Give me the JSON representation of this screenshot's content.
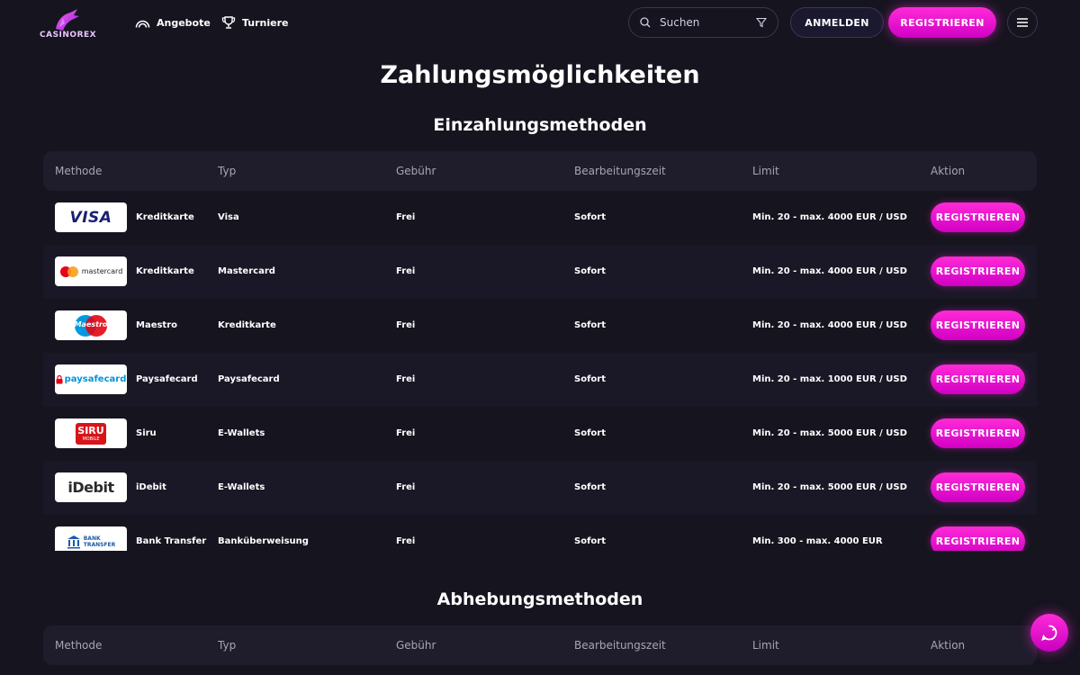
{
  "header": {
    "logo_text": "CASINOREX",
    "nav": [
      {
        "label": "Angebote",
        "icon": "gauge-icon"
      },
      {
        "label": "Turniere",
        "icon": "trophy-icon"
      }
    ],
    "search_placeholder": "Suchen",
    "login_label": "ANMELDEN",
    "register_label": "REGISTRIEREN"
  },
  "page_title": "Zahlungsmöglichkeiten",
  "deposit": {
    "title": "Einzahlungsmethoden",
    "columns": [
      "Methode",
      "Typ",
      "Gebühr",
      "Bearbeitungszeit",
      "Limit",
      "Aktion"
    ],
    "rows": [
      {
        "logo": "visa",
        "method": "Kreditkarte",
        "type": "Visa",
        "fee": "Frei",
        "time": "Sofort",
        "limit": "Min. 20 - max. 4000 EUR / USD",
        "action": "REGISTRIEREN"
      },
      {
        "logo": "mastercard",
        "method": "Kreditkarte",
        "type": "Mastercard",
        "fee": "Frei",
        "time": "Sofort",
        "limit": "Min. 20 - max. 4000 EUR / USD",
        "action": "REGISTRIEREN"
      },
      {
        "logo": "maestro",
        "method": "Maestro",
        "type": "Kreditkarte",
        "fee": "Frei",
        "time": "Sofort",
        "limit": "Min. 20 - max. 4000 EUR / USD",
        "action": "REGISTRIEREN"
      },
      {
        "logo": "paysafecard",
        "method": "Paysafecard",
        "type": "Paysafecard",
        "fee": "Frei",
        "time": "Sofort",
        "limit": "Min. 20 - max. 1000 EUR / USD",
        "action": "REGISTRIEREN"
      },
      {
        "logo": "siru",
        "method": "Siru",
        "type": "E-Wallets",
        "fee": "Frei",
        "time": "Sofort",
        "limit": "Min. 20 - max. 5000 EUR / USD",
        "action": "REGISTRIEREN"
      },
      {
        "logo": "idebit",
        "method": "iDebit",
        "type": "E-Wallets",
        "fee": "Frei",
        "time": "Sofort",
        "limit": "Min. 20 - max. 5000 EUR / USD",
        "action": "REGISTRIEREN"
      },
      {
        "logo": "bank-transfer",
        "method": "Bank Transfer",
        "type": "Banküberweisung",
        "fee": "Frei",
        "time": "Sofort",
        "limit": "Min. 300 - max. 4000 EUR",
        "action": "REGISTRIEREN"
      }
    ]
  },
  "withdrawal": {
    "title": "Abhebungsmethoden",
    "columns": [
      "Methode",
      "Typ",
      "Gebühr",
      "Bearbeitungszeit",
      "Limit",
      "Aktion"
    ]
  },
  "logo_text": {
    "visa": "VISA",
    "mastercard": "mastercard",
    "maestro": "Maestro",
    "paysafecard": "paysafecard",
    "siru": "SIRU",
    "siru_sub": "MOBILE",
    "idebit": "iDebit",
    "bank_1": "BANK",
    "bank_2": "TRANSFER"
  },
  "colors": {
    "background": "#16141f",
    "accent": "#ff2bd8",
    "table_header": "#1f1d2b"
  }
}
